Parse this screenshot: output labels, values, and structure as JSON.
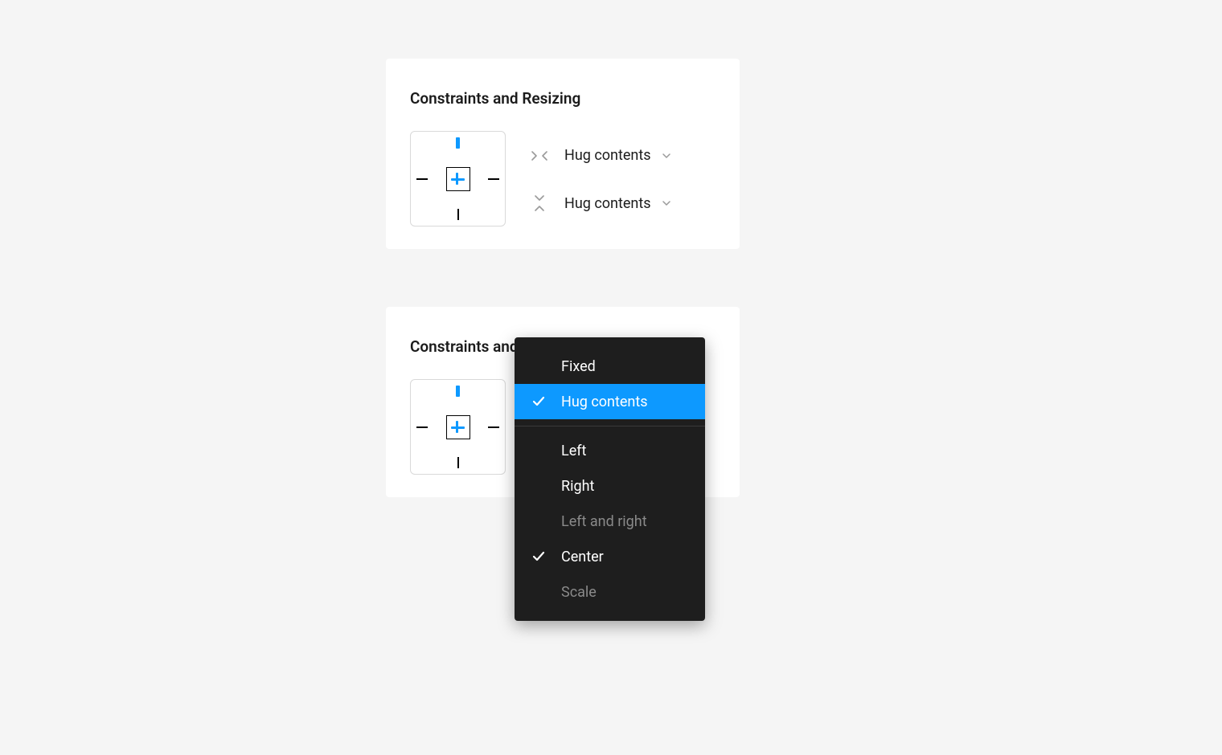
{
  "panels": {
    "top": {
      "title": "Constraints and Resizing",
      "rows": [
        {
          "label": "Hug contents"
        },
        {
          "label": "Hug contents"
        }
      ]
    },
    "bottom": {
      "title": "Constraints and Resizing"
    }
  },
  "menu": {
    "items": [
      {
        "label": "Fixed",
        "checked": false,
        "selected": false,
        "disabled": false
      },
      {
        "label": "Hug contents",
        "checked": true,
        "selected": true,
        "disabled": false
      },
      {
        "sep": true
      },
      {
        "label": "Left",
        "checked": false,
        "selected": false,
        "disabled": false
      },
      {
        "label": "Right",
        "checked": false,
        "selected": false,
        "disabled": false
      },
      {
        "label": "Left and right",
        "checked": false,
        "selected": false,
        "disabled": true
      },
      {
        "label": "Center",
        "checked": true,
        "selected": false,
        "disabled": false
      },
      {
        "label": "Scale",
        "checked": false,
        "selected": false,
        "disabled": true
      }
    ]
  },
  "colors": {
    "accent": "#0d99ff"
  }
}
